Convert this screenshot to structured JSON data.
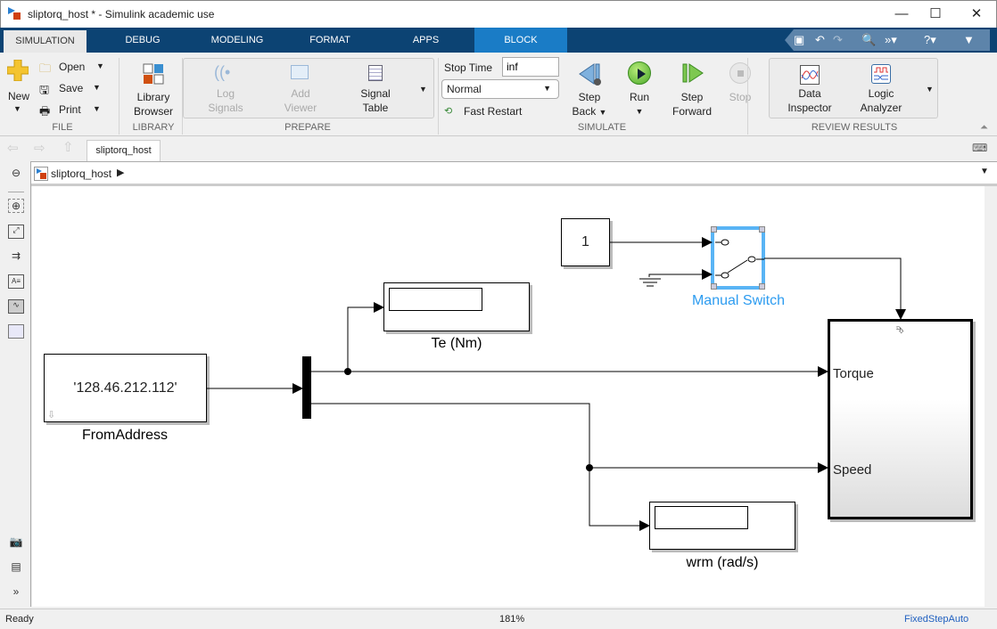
{
  "window": {
    "title": "sliptorq_host * - Simulink academic use",
    "minimize": "—",
    "maximize": "☐",
    "close": "✕"
  },
  "ribbon_tabs": [
    "SIMULATION",
    "DEBUG",
    "MODELING",
    "FORMAT",
    "APPS",
    "BLOCK"
  ],
  "file": {
    "new": "New",
    "open": "Open",
    "save": "Save",
    "print": "Print",
    "group": "FILE"
  },
  "library": {
    "browser_l1": "Library",
    "browser_l2": "Browser",
    "group": "LIBRARY"
  },
  "prepare": {
    "log_l1": "Log",
    "log_l2": "Signals",
    "viewer_l1": "Add",
    "viewer_l2": "Viewer",
    "table_l1": "Signal",
    "table_l2": "Table",
    "group": "PREPARE"
  },
  "simulate": {
    "stop_time_label": "Stop Time",
    "stop_time_value": "inf",
    "mode": "Normal",
    "fast_restart": "Fast Restart",
    "step_back_l1": "Step",
    "step_back_l2": "Back",
    "run": "Run",
    "step_fwd_l1": "Step",
    "step_fwd_l2": "Forward",
    "stop": "Stop",
    "group": "SIMULATE"
  },
  "review": {
    "inspector_l1": "Data",
    "inspector_l2": "Inspector",
    "logic_l1": "Logic",
    "logic_l2": "Analyzer",
    "group": "REVIEW RESULTS"
  },
  "doc_tab": "sliptorq_host",
  "breadcrumb": "sliptorq_host",
  "diagram": {
    "constant_value": "1",
    "manual_switch_label": "Manual Switch",
    "te_display_label": "Te (Nm)",
    "from_address_value": "'128.46.212.112'",
    "from_address_label": "FromAddress",
    "subsystem_ports": [
      "Torque",
      "Speed"
    ],
    "wrm_display_label": "wrm (rad/s)",
    "selection_color": "#59b4f5"
  },
  "status": {
    "left": "Ready",
    "zoom": "181%",
    "solver": "FixedStepAuto"
  }
}
